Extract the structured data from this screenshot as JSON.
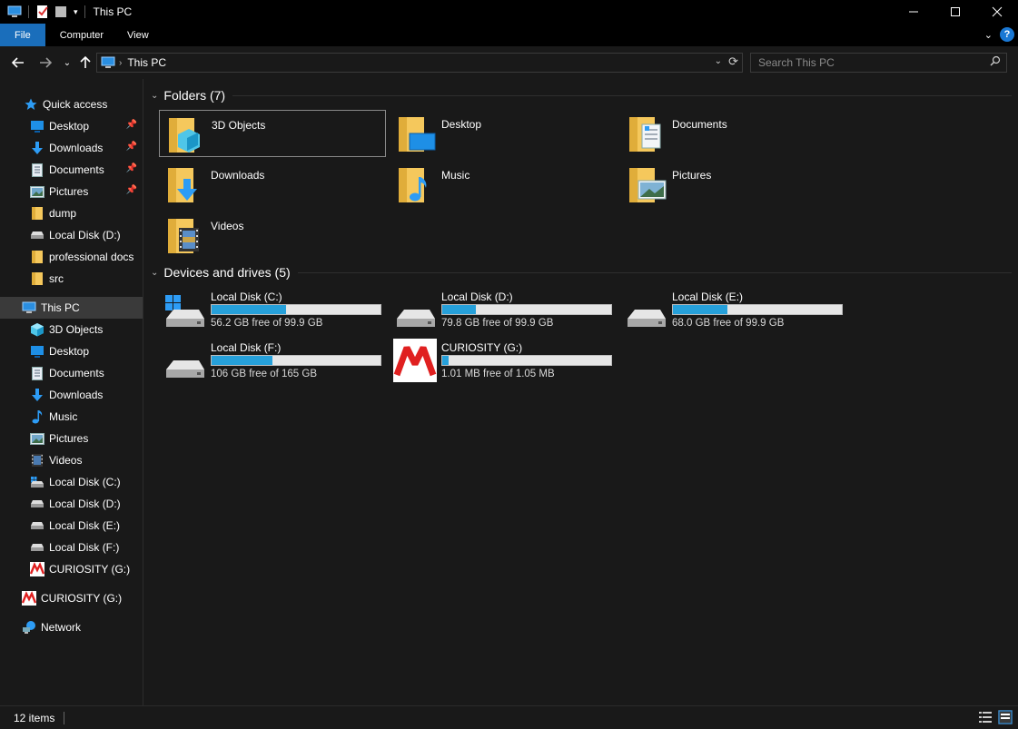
{
  "window": {
    "title": "This PC"
  },
  "ribbon": {
    "tabs": [
      "File",
      "Computer",
      "View"
    ],
    "help_label": "?"
  },
  "address": {
    "crumb": "This PC"
  },
  "search": {
    "placeholder": "Search This PC"
  },
  "sidebar": {
    "quick_access": {
      "label": "Quick access",
      "items": [
        {
          "label": "Desktop",
          "icon": "desktop-icon",
          "pinned": true
        },
        {
          "label": "Downloads",
          "icon": "downloads-icon",
          "pinned": true
        },
        {
          "label": "Documents",
          "icon": "documents-icon",
          "pinned": true
        },
        {
          "label": "Pictures",
          "icon": "pictures-icon",
          "pinned": true
        },
        {
          "label": "dump",
          "icon": "folder-icon",
          "pinned": false
        },
        {
          "label": "Local Disk (D:)",
          "icon": "drive-icon",
          "pinned": false
        },
        {
          "label": "professional docs",
          "icon": "folder-icon",
          "pinned": false
        },
        {
          "label": "src",
          "icon": "folder-icon",
          "pinned": false
        }
      ]
    },
    "this_pc": {
      "label": "This PC",
      "items": [
        {
          "label": "3D Objects",
          "icon": "3d-objects-icon"
        },
        {
          "label": "Desktop",
          "icon": "desktop-icon"
        },
        {
          "label": "Documents",
          "icon": "documents-icon"
        },
        {
          "label": "Downloads",
          "icon": "downloads-icon"
        },
        {
          "label": "Music",
          "icon": "music-icon"
        },
        {
          "label": "Pictures",
          "icon": "pictures-icon"
        },
        {
          "label": "Videos",
          "icon": "videos-icon"
        },
        {
          "label": "Local Disk (C:)",
          "icon": "windows-drive-icon"
        },
        {
          "label": "Local Disk (D:)",
          "icon": "drive-icon"
        },
        {
          "label": "Local Disk (E:)",
          "icon": "drive-icon"
        },
        {
          "label": "Local Disk (F:)",
          "icon": "drive-icon"
        },
        {
          "label": "CURIOSITY (G:)",
          "icon": "microchip-logo-icon"
        }
      ]
    },
    "removable": {
      "label": "CURIOSITY (G:)"
    },
    "network": {
      "label": "Network"
    }
  },
  "main": {
    "folders_header": "Folders (7)",
    "folders": [
      {
        "label": "3D Objects",
        "icon": "3d-objects-icon"
      },
      {
        "label": "Desktop",
        "icon": "desktop-icon"
      },
      {
        "label": "Documents",
        "icon": "documents-icon"
      },
      {
        "label": "Downloads",
        "icon": "downloads-icon"
      },
      {
        "label": "Music",
        "icon": "music-icon"
      },
      {
        "label": "Pictures",
        "icon": "pictures-icon"
      },
      {
        "label": "Videos",
        "icon": "videos-icon"
      }
    ],
    "drives_header": "Devices and drives (5)",
    "drives": [
      {
        "label": "Local Disk (C:)",
        "free_text": "56.2 GB free of 99.9 GB",
        "used_fraction": 0.44,
        "icon": "windows-drive-icon"
      },
      {
        "label": "Local Disk (D:)",
        "free_text": "79.8 GB free of 99.9 GB",
        "used_fraction": 0.2,
        "icon": "drive-icon"
      },
      {
        "label": "Local Disk (E:)",
        "free_text": "68.0 GB free of 99.9 GB",
        "used_fraction": 0.32,
        "icon": "drive-icon"
      },
      {
        "label": "Local Disk (F:)",
        "free_text": "106 GB free of 165 GB",
        "used_fraction": 0.36,
        "icon": "drive-icon"
      },
      {
        "label": "CURIOSITY (G:)",
        "free_text": "1.01 MB free of 1.05 MB",
        "used_fraction": 0.04,
        "icon": "microchip-logo-icon"
      }
    ]
  },
  "status": {
    "items_count": "12 items"
  },
  "colors": {
    "accent": "#1a6ebb",
    "bar_fill": "#26a0da",
    "background": "#191919"
  }
}
